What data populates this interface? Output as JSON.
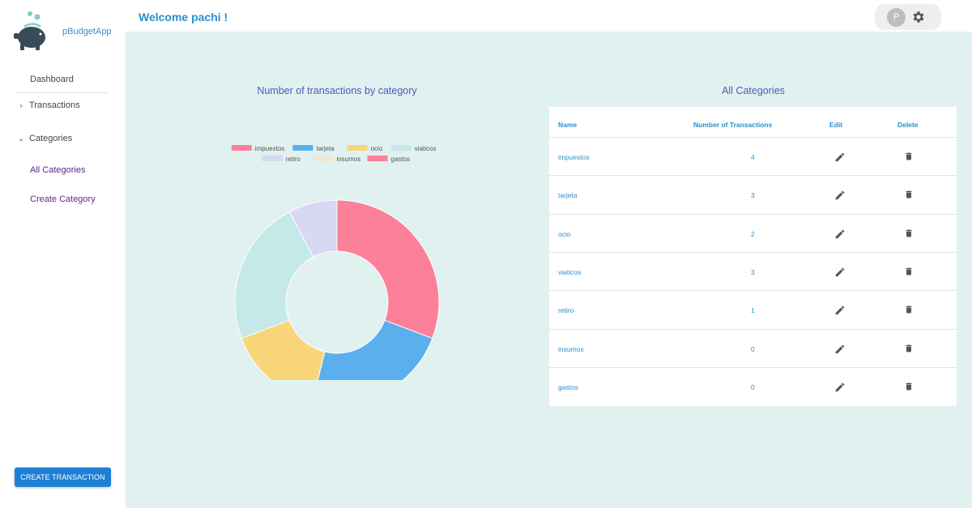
{
  "app": {
    "brand": "pBudgetApp"
  },
  "header": {
    "welcome": "Welcome pachi !",
    "avatar_initial": "P"
  },
  "sidebar": {
    "dashboard": "Dashboard",
    "transactions": "Transactions",
    "categories": "Categories",
    "sub_items": [
      "All Categories",
      "Create Category"
    ],
    "create_button": "CREATE TRANSACTION"
  },
  "chart_section": {
    "title": "Number of transactions by category"
  },
  "categories_section": {
    "title": "All Categories"
  },
  "table": {
    "headers": {
      "name": "Name",
      "count": "Number of Transactions",
      "edit": "Edit",
      "delete": "Delete"
    },
    "rows": [
      {
        "name": "impuestos",
        "count": "4"
      },
      {
        "name": "tarjeta",
        "count": "3"
      },
      {
        "name": "ocio",
        "count": "2"
      },
      {
        "name": "viaticos",
        "count": "3"
      },
      {
        "name": "retiro",
        "count": "1"
      },
      {
        "name": "insumos",
        "count": "0"
      },
      {
        "name": "gastos",
        "count": "0"
      }
    ]
  },
  "chart_data": {
    "type": "pie",
    "title": "Number of transactions by category",
    "categories": [
      "impuestos",
      "tarjeta",
      "ocio",
      "viaticos",
      "retiro",
      "insumos",
      "gastos"
    ],
    "values": [
      4,
      3,
      2,
      3,
      1,
      0,
      0
    ],
    "colors": [
      "#fb8098",
      "#5aafec",
      "#f9d57a",
      "#c4e9e8",
      "#d7d8f3",
      "#efe7d4",
      "#fb8098"
    ],
    "legend_position": "top",
    "donut": true
  }
}
